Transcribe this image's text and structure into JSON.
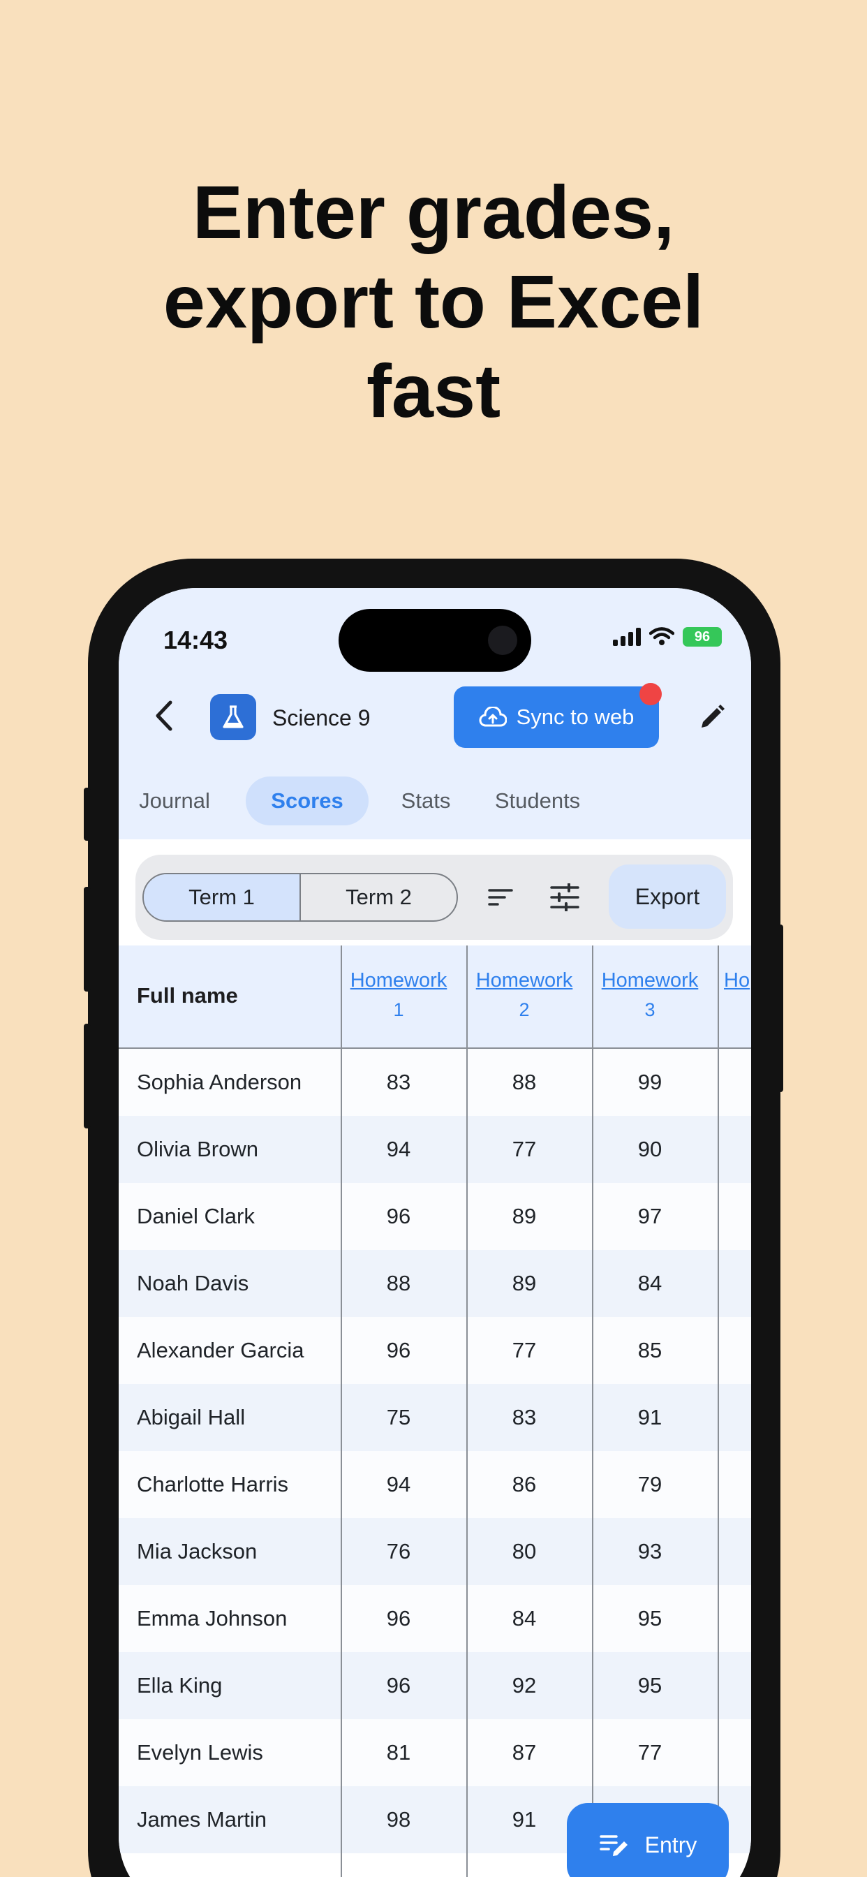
{
  "headline": [
    "Enter grades,",
    "export to Excel",
    "fast"
  ],
  "status_bar": {
    "time": "14:43",
    "battery": "96"
  },
  "header": {
    "class_name": "Science 9",
    "sync_label": "Sync to web"
  },
  "tabs": [
    {
      "label": "Journal"
    },
    {
      "label": "Scores",
      "active": true
    },
    {
      "label": "Stats"
    },
    {
      "label": "Students"
    }
  ],
  "toolbar": {
    "term1": "Term 1",
    "term2": "Term 2",
    "export_label": "Export"
  },
  "table": {
    "name_header": "Full name",
    "columns": [
      {
        "title": "Homework",
        "number": "1"
      },
      {
        "title": "Homework",
        "number": "2"
      },
      {
        "title": "Homework",
        "number": "3"
      },
      {
        "title": "Ho",
        "number": ""
      }
    ],
    "rows": [
      {
        "name": "Sophia Anderson",
        "scores": [
          "83",
          "88",
          "99"
        ]
      },
      {
        "name": "Olivia Brown",
        "scores": [
          "94",
          "77",
          "90"
        ]
      },
      {
        "name": "Daniel Clark",
        "scores": [
          "96",
          "89",
          "97"
        ]
      },
      {
        "name": "Noah Davis",
        "scores": [
          "88",
          "89",
          "84"
        ]
      },
      {
        "name": "Alexander Garcia",
        "scores": [
          "96",
          "77",
          "85"
        ]
      },
      {
        "name": "Abigail Hall",
        "scores": [
          "75",
          "83",
          "91"
        ]
      },
      {
        "name": "Charlotte Harris",
        "scores": [
          "94",
          "86",
          "79"
        ]
      },
      {
        "name": "Mia Jackson",
        "scores": [
          "76",
          "80",
          "93"
        ]
      },
      {
        "name": "Emma Johnson",
        "scores": [
          "96",
          "84",
          "95"
        ]
      },
      {
        "name": "Ella King",
        "scores": [
          "96",
          "92",
          "95"
        ]
      },
      {
        "name": "Evelyn Lewis",
        "scores": [
          "81",
          "87",
          "77"
        ]
      },
      {
        "name": "James Martin",
        "scores": [
          "98",
          "91",
          ""
        ]
      }
    ]
  },
  "fab": {
    "label": "Entry"
  },
  "colors": {
    "accent": "#2f80ed",
    "background": "#f9e0bd",
    "badge": "#ef4444"
  }
}
